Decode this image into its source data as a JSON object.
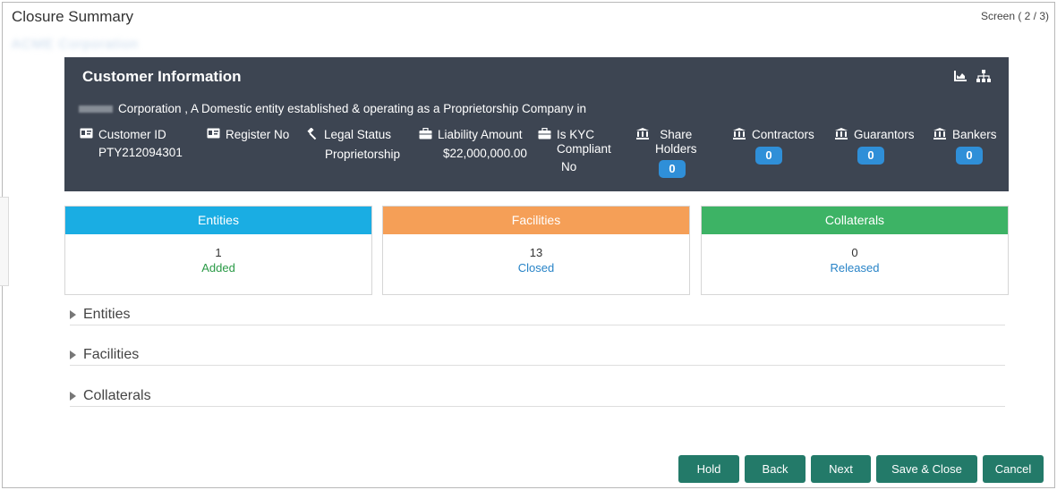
{
  "header": {
    "title": "Closure Summary",
    "screen_indicator": "Screen ( 2 / 3)",
    "company_name_blurred": "ACME Corporation"
  },
  "customer_info": {
    "title": "Customer Information",
    "icons": [
      "chart-icon",
      "hierarchy-icon"
    ],
    "description": "Corporation , A Domestic entity established & operating as a Proprietorship Company in",
    "fields": {
      "customer_id": {
        "label": "Customer ID",
        "value": "PTY212094301",
        "icon": "id-card-icon"
      },
      "register_no": {
        "label": "Register No",
        "value": "",
        "icon": "id-card-icon"
      },
      "legal_status": {
        "label": "Legal Status",
        "value": "Proprietorship",
        "icon": "gavel-icon"
      },
      "liability_amount": {
        "label": "Liability Amount",
        "value": "$22,000,000.00",
        "icon": "briefcase-icon"
      },
      "is_kyc": {
        "label_line1": "Is KYC",
        "label_line2": "Compliant",
        "value": "No",
        "icon": "briefcase-icon"
      },
      "share_holders": {
        "label_line1": "Share",
        "label_line2": "Holders",
        "count": "0",
        "icon": "bank-icon"
      },
      "contractors": {
        "label": "Contractors",
        "count": "0",
        "icon": "bank-icon"
      },
      "guarantors": {
        "label": "Guarantors",
        "count": "0",
        "icon": "bank-icon"
      },
      "bankers": {
        "label": "Bankers",
        "count": "0",
        "icon": "bank-icon"
      }
    },
    "colors": {
      "background": "#3d4552",
      "pill": "#2f8fd8"
    }
  },
  "summary_cards": [
    {
      "title": "Entities",
      "count": "1",
      "status": "Added",
      "color": "#1aade3",
      "status_color": "#2a9a46"
    },
    {
      "title": "Facilities",
      "count": "13",
      "status": "Closed",
      "color": "#f59f57",
      "status_color": "#2783c7"
    },
    {
      "title": "Collaterals",
      "count": "0",
      "status": "Released",
      "color": "#3db365",
      "status_color": "#2783c7"
    }
  ],
  "sections": [
    {
      "label": "Entities"
    },
    {
      "label": "Facilities"
    },
    {
      "label": "Collaterals"
    }
  ],
  "footer_buttons": {
    "hold": "Hold",
    "back": "Back",
    "next": "Next",
    "save_close": "Save & Close",
    "cancel": "Cancel",
    "color": "#237a69"
  }
}
